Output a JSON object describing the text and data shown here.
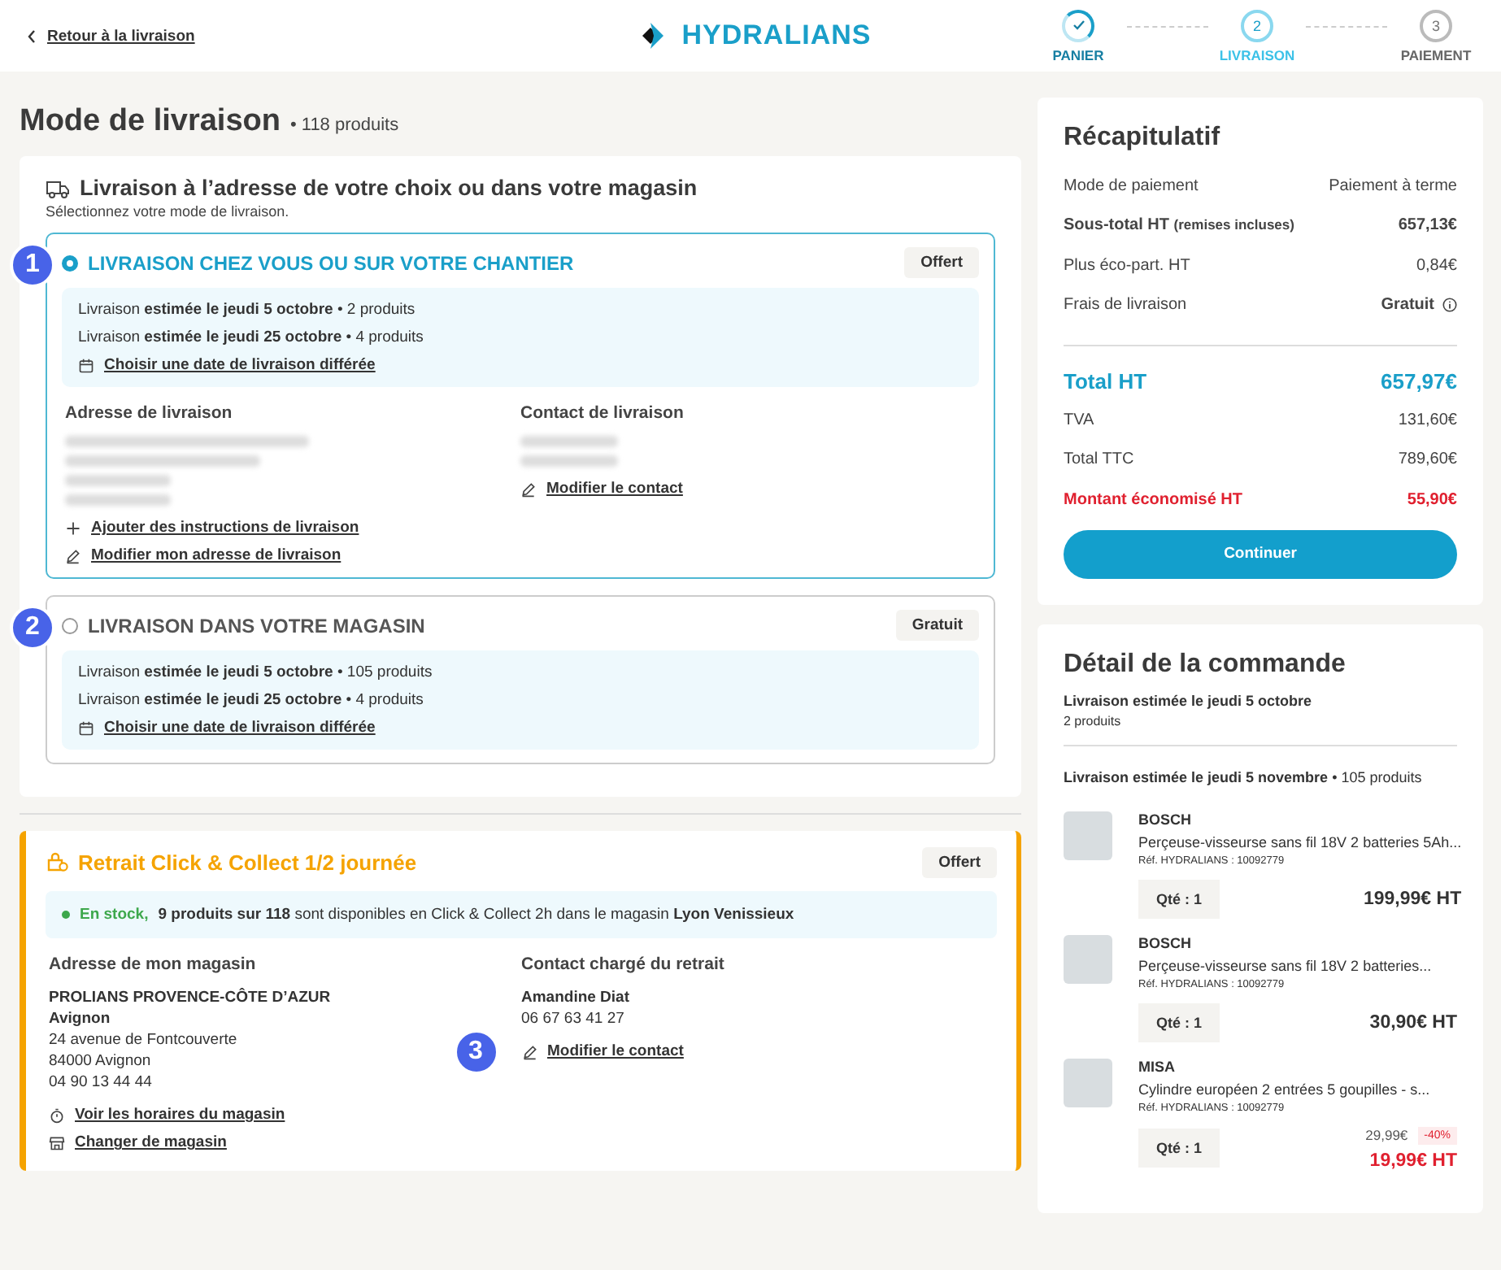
{
  "header": {
    "back_link": "Retour à la livraison",
    "logo": "HYDRALIANS",
    "steps": [
      {
        "label": "PANIER",
        "completed": true,
        "selected": false
      },
      {
        "label": "LIVRAISON",
        "number": "2",
        "completed": false,
        "selected": true
      },
      {
        "label": "PAIEMENT",
        "number": "3",
        "completed": false,
        "selected": false
      }
    ]
  },
  "page": {
    "title": "Mode de livraison",
    "count": "• 118 produits"
  },
  "delivery": {
    "heading": "Livraison à l’adresse de votre choix ou dans votre magasin",
    "subheading": "Sélectionnez votre mode de livraison.",
    "options": [
      {
        "marker": "1",
        "title": "LIVRAISON CHEZ VOUS OU SUR VOTRE CHANTIER",
        "selected": true,
        "price": "Offert",
        "lines": [
          "Livraison **estimée le jeudi 5 octobre** • 2 produits",
          "Livraison **estimée le jeudi 25 octobre** • 4 produits"
        ],
        "date_link": "Choisir une date de livraison différée",
        "address": {
          "title": "Adresse de livraison",
          "links": [
            {
              "kind": "add",
              "label": "Ajouter des instructions de livraison"
            },
            {
              "kind": "edit",
              "label": "Modifier mon adresse de livraison"
            }
          ]
        },
        "contact": {
          "title": "Contact de livraison",
          "link": "Modifier le contact"
        }
      },
      {
        "marker": "2",
        "title": "LIVRAISON DANS VOTRE MAGASIN",
        "selected": false,
        "price": "Gratuit",
        "lines": [
          "Livraison **estimée le jeudi 5 octobre** • 105 produits",
          "Livraison **estimée le jeudi 25 octobre** • 4 produits"
        ],
        "date_link": "Choisir une date de livraison différée"
      }
    ]
  },
  "click_collect": {
    "title": "Retrait Click & Collect 1/2 journée",
    "price": "Offert",
    "stock_status": "En stock,",
    "stock_text": "**9 produits sur 118** sont disponibles en Click & Collect 2h dans le magasin **Lyon Venissieux**",
    "store": {
      "title": "Adresse de mon magasin",
      "name": "PROLIANS PROVENCE-CÔTE D’AZUR",
      "city": "Avignon",
      "lines": [
        "24 avenue de Fontcouverte",
        "84000 Avignon",
        "04 90 13 44 44"
      ],
      "links": [
        {
          "kind": "hours",
          "label": "Voir les horaires du magasin"
        },
        {
          "kind": "store",
          "label": "Changer de magasin"
        }
      ]
    },
    "contact": {
      "title": "Contact chargé du retrait",
      "name": "Amandine Diat",
      "phone": "06 67 63 41 27",
      "link": "Modifier le contact",
      "marker": "3"
    }
  },
  "summary": {
    "title": "Récapitulatif",
    "rows": [
      {
        "kind": "plain",
        "label": "Mode de paiement",
        "value": "Paiement à terme"
      },
      {
        "kind": "bold",
        "label": "Sous-total HT",
        "note": "(remises incluses)",
        "value": "657,13€"
      },
      {
        "kind": "plain",
        "label": "Plus éco-part. HT",
        "value": "0,84€"
      },
      {
        "kind": "info",
        "label": "Frais de livraison",
        "value": "Gratuit"
      },
      {
        "kind": "total",
        "label": "Total HT",
        "value": "657,97€"
      },
      {
        "kind": "plain",
        "label": "TVA",
        "value": "131,60€"
      },
      {
        "kind": "plain",
        "label": "Total TTC",
        "value": "789,60€"
      },
      {
        "kind": "savings",
        "label": "Montant économisé HT",
        "value": "55,90€"
      }
    ],
    "button": "Continuer"
  },
  "order": {
    "title": "Détail de la commande",
    "group1": {
      "title": "Livraison estimée le jeudi 5 octobre",
      "count": "2 produits"
    },
    "group2": "**Livraison estimée le jeudi 5 novembre** • 105 produits",
    "products": [
      {
        "brand": "BOSCH",
        "name": "Perçeuse-visseurse sans fil 18V 2 batteries 5Ah...",
        "ref": "Réf. HYDRALIANS : 10092779",
        "qty": "Qté : 1",
        "price": "199,99€ HT"
      },
      {
        "brand": "BOSCH",
        "name": "Perçeuse-visseurse sans fil 18V 2 batteries...",
        "ref": "Réf. HYDRALIANS : 10092779",
        "qty": "Qté : 1",
        "price": "30,90€ HT"
      },
      {
        "brand": "MISA",
        "name": "Cylindre européen 2 entrées 5 goupilles - s...",
        "ref": "Réf. HYDRALIANS : 10092779",
        "qty": "Qté : 1",
        "price": "19,99€ HT",
        "old_price": "29,99€",
        "discount": "-40%"
      }
    ]
  }
}
